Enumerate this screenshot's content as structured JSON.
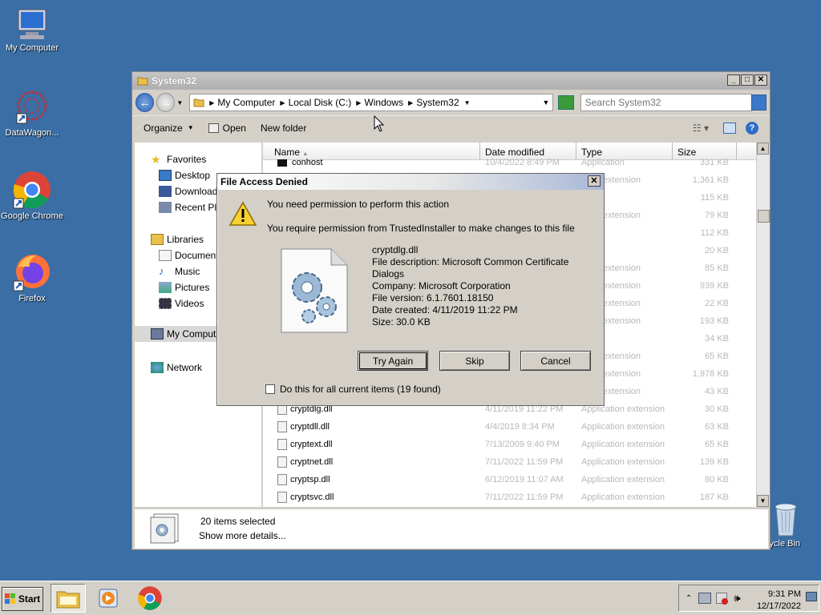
{
  "desktop": {
    "icons": [
      {
        "label": "My Computer"
      },
      {
        "label": "DataWagon..."
      },
      {
        "label": "Google Chrome"
      },
      {
        "label": "Firefox"
      },
      {
        "label": "cycle Bin"
      }
    ]
  },
  "explorer": {
    "title": "System32",
    "breadcrumb": [
      "My Computer",
      "Local Disk (C:)",
      "Windows",
      "System32"
    ],
    "search_placeholder": "Search System32",
    "toolbar": {
      "organize": "Organize",
      "open": "Open",
      "new_folder": "New folder"
    },
    "nav": {
      "favorites": "Favorites",
      "desktop": "Desktop",
      "downloads": "Downloads",
      "recent": "Recent Pla",
      "libraries": "Libraries",
      "documents": "Documents",
      "music": "Music",
      "pictures": "Pictures",
      "videos": "Videos",
      "my_computer": "My Computer",
      "network": "Network"
    },
    "columns": {
      "name": "Name",
      "date": "Date modified",
      "type": "Type",
      "size": "Size"
    },
    "top_row": {
      "name": "conhost",
      "date": "10/4/2022 8:49 PM",
      "type": "Application",
      "size": "331 KB"
    },
    "hidden_rows": [
      {
        "type": "ation extension",
        "size": "1,361 KB"
      },
      {
        "type": "ation",
        "size": "115 KB"
      },
      {
        "type": "ation extension",
        "size": "79 KB"
      },
      {
        "type": "ation",
        "size": "112 KB"
      },
      {
        "type": "ation",
        "size": "20 KB"
      },
      {
        "type": "ation extension",
        "size": "85 KB"
      },
      {
        "type": "ation extension",
        "size": "939 KB"
      },
      {
        "type": "ation extension",
        "size": "22 KB"
      },
      {
        "type": "ation extension",
        "size": "193 KB"
      },
      {
        "type": "ation",
        "size": "34 KB"
      },
      {
        "type": "ation extension",
        "size": "65 KB"
      },
      {
        "type": "ation extension",
        "size": "1,978 KB"
      },
      {
        "type": "ation extension",
        "size": "43 KB"
      }
    ],
    "rows": [
      {
        "name": "cryptdlg.dll",
        "date": "4/11/2019 11:22 PM",
        "type": "Application extension",
        "size": "30 KB"
      },
      {
        "name": "cryptdll.dll",
        "date": "4/4/2019 8:34 PM",
        "type": "Application extension",
        "size": "63 KB"
      },
      {
        "name": "cryptext.dll",
        "date": "7/13/2009 9:40 PM",
        "type": "Application extension",
        "size": "65 KB"
      },
      {
        "name": "cryptnet.dll",
        "date": "7/11/2022 11:59 PM",
        "type": "Application extension",
        "size": "139 KB"
      },
      {
        "name": "cryptsp.dll",
        "date": "6/12/2019 11:07 AM",
        "type": "Application extension",
        "size": "80 KB"
      },
      {
        "name": "cryptsvc.dll",
        "date": "7/11/2022 11:59 PM",
        "type": "Application extension",
        "size": "187 KB"
      }
    ],
    "details": {
      "selected": "20 items selected",
      "more": "Show more details..."
    }
  },
  "dialog": {
    "title": "File Access Denied",
    "headline": "You need permission to perform this action",
    "subline": "You require permission from TrustedInstaller to make changes to this file",
    "file": {
      "name": "cryptdlg.dll",
      "description": "File description: Microsoft Common Certificate Dialogs",
      "company": "Company: Microsoft Corporation",
      "version": "File version: 6.1.7601.18150",
      "created": "Date created: 4/11/2019 11:22 PM",
      "size": "Size: 30.0 KB"
    },
    "buttons": {
      "try_again": "Try Again",
      "skip": "Skip",
      "cancel": "Cancel"
    },
    "checkbox": "Do this for all current items (19 found)"
  },
  "taskbar": {
    "start": "Start",
    "time": "9:31 PM",
    "date": "12/17/2022"
  }
}
